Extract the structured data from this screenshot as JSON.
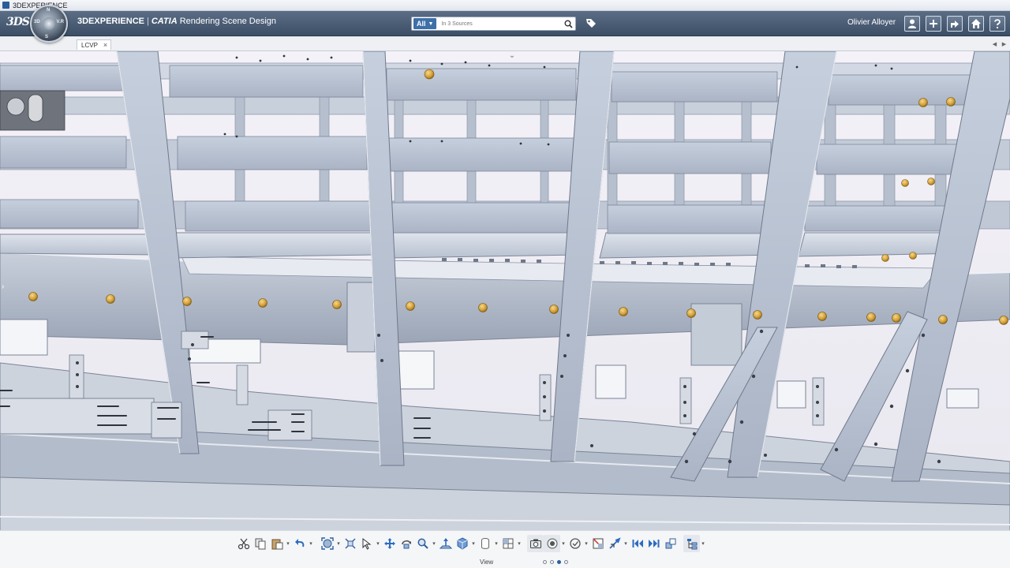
{
  "window": {
    "title": "3DEXPERIENCE"
  },
  "header": {
    "brand": "3DEXPERIENCE",
    "separator": "|",
    "product": "CATIA",
    "app_name": "Rendering Scene Design",
    "compass": {
      "n": "N",
      "w": "3D",
      "e": "V.R",
      "s": "S"
    },
    "search": {
      "scope": "All",
      "placeholder": "In 3 Sources"
    },
    "user_name": "Olivier Alloyer",
    "icons": [
      "user-icon",
      "add-icon",
      "share-icon",
      "home-icon",
      "help-icon"
    ]
  },
  "tabs": [
    {
      "label": "LCVP",
      "close": "×"
    }
  ],
  "viewport": {
    "content": "3D ship hull frame assembly model",
    "colors": {
      "background": "#f2f0f6",
      "structure": "#bcc6d6",
      "fastener": "#d4a23a"
    }
  },
  "action_bar": {
    "section_label": "View",
    "pages": 4,
    "active_page": 3,
    "tools": [
      "cut-icon",
      "copy-icon",
      "paste-icon",
      "undo-icon",
      "fit-all-icon",
      "zoom-area-icon",
      "select-icon",
      "pan-icon",
      "rotate-icon",
      "zoom-icon",
      "normal-view-icon",
      "iso-view-icon",
      "cylinder-icon",
      "split-view-icon",
      "capture-icon",
      "visualization-icon",
      "cull-icon",
      "section-icon",
      "fly-icon",
      "first-frame-icon",
      "last-frame-icon",
      "swap-icon",
      "tree-icon"
    ]
  },
  "colors": {
    "topbar": "#4a5d75",
    "accent": "#3e6fa8"
  }
}
